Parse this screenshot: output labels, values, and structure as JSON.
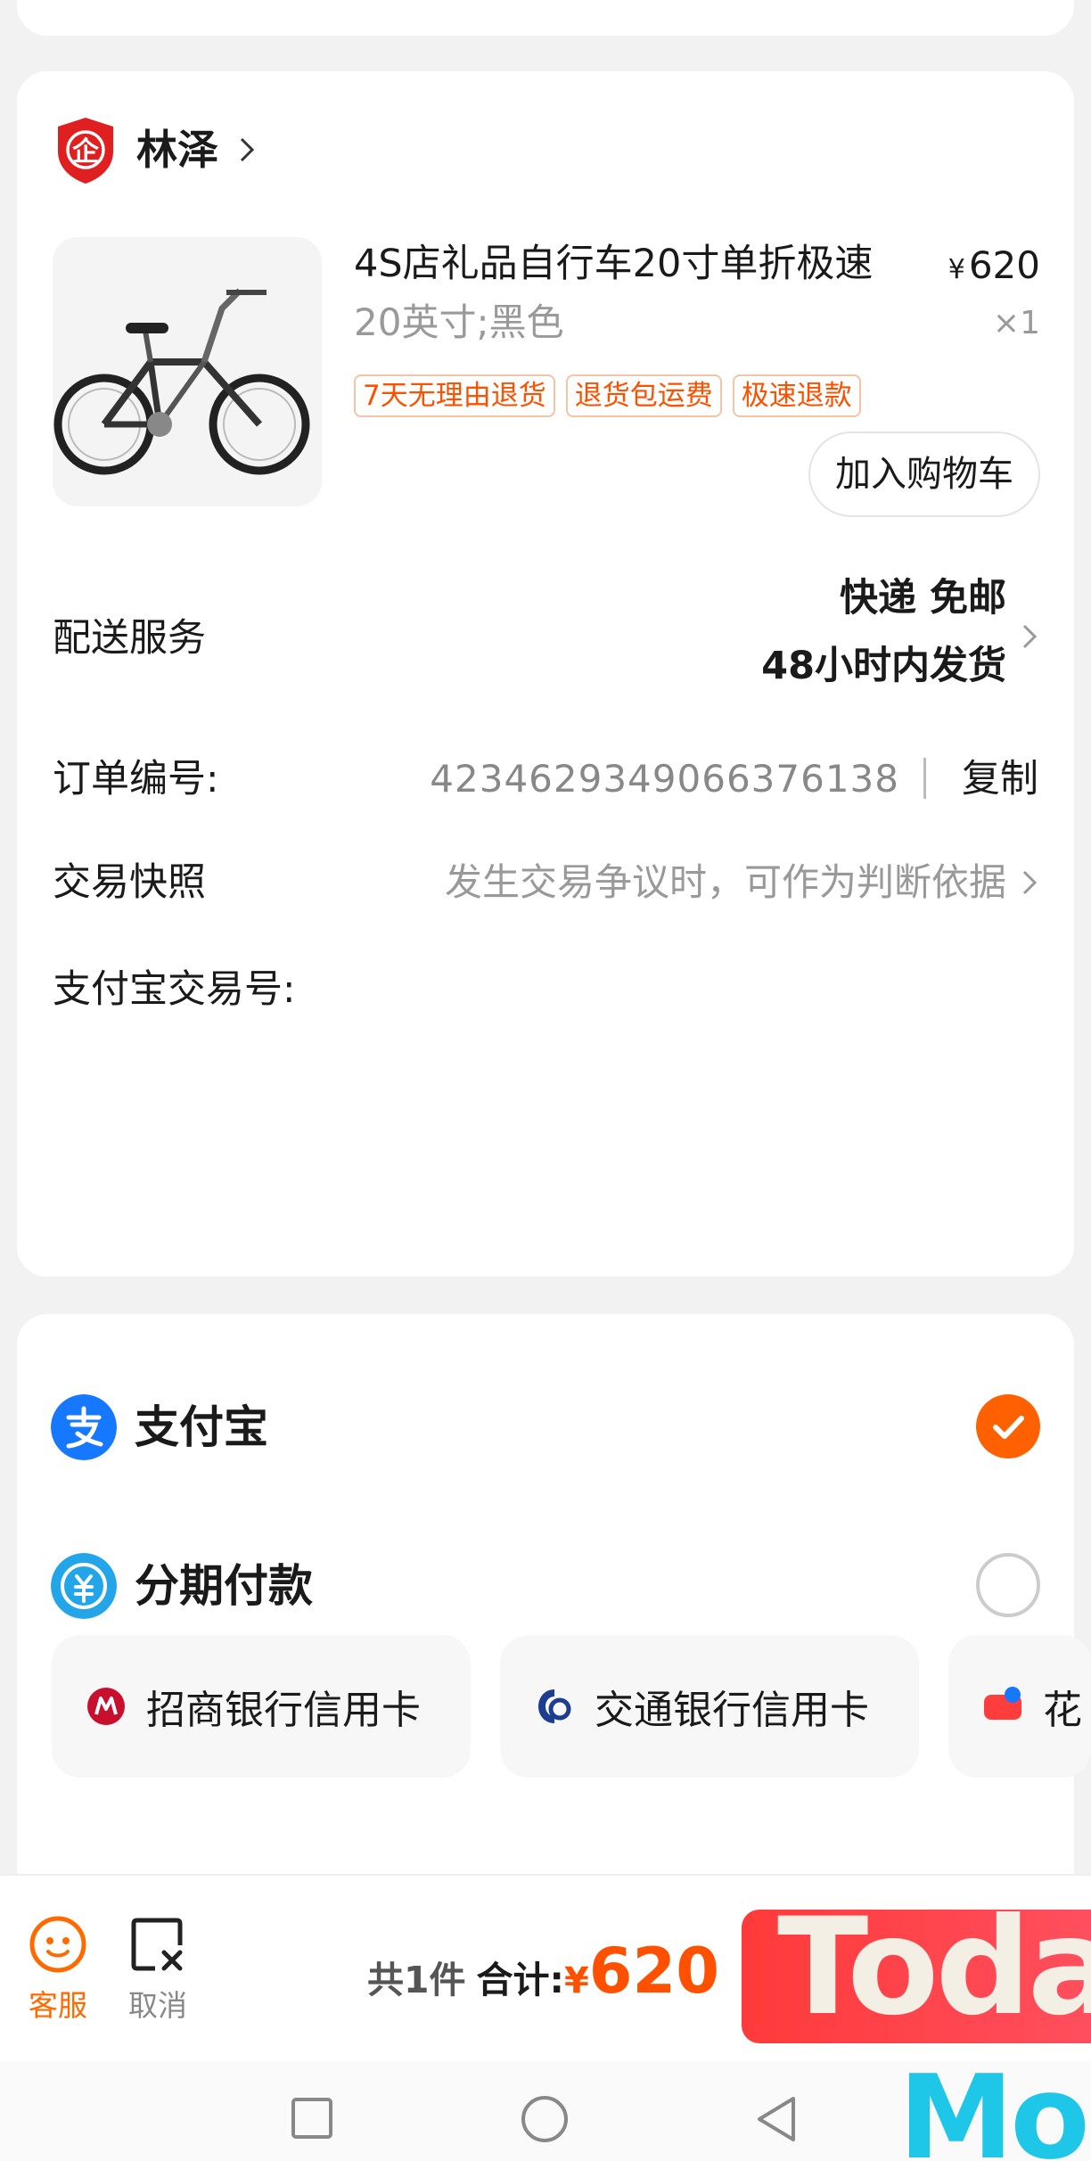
{
  "shop": {
    "name": "林泽",
    "badge_glyph": "企"
  },
  "product": {
    "title": "4S店礼品自行车20寸单折极速",
    "price_symbol": "¥",
    "price": "620",
    "spec": "20英寸;黑色",
    "quantity": "×1",
    "tags": [
      "7天无理由退货",
      "退货包运费",
      "极速退款"
    ],
    "add_to_cart": "加入购物车",
    "image": "folding-bicycle-photo"
  },
  "delivery": {
    "label": "配送服务",
    "line1": "快递 免邮",
    "line2": "48小时内发货"
  },
  "order_number": {
    "label": "订单编号:",
    "value": "4234629349066376138",
    "copy": "复制"
  },
  "snapshot": {
    "label": "交易快照",
    "desc": "发生交易争议时，可作为判断依据"
  },
  "alipay_trade_no": {
    "label": "支付宝交易号:"
  },
  "payment": {
    "methods": [
      {
        "label": "支付宝",
        "icon": "alipay-icon",
        "selected": true,
        "color": "#1677ff"
      },
      {
        "label": "分期付款",
        "icon": "installment-icon",
        "selected": false,
        "color": "#23a6e9"
      }
    ],
    "banks": [
      {
        "label": "招商银行信用卡",
        "icon": "cmb-bank-icon"
      },
      {
        "label": "交通银行信用卡",
        "icon": "bocom-bank-icon"
      },
      {
        "label": "花",
        "icon": "huabei-installment-icon"
      }
    ]
  },
  "bottom_bar": {
    "service": "客服",
    "cancel": "取消",
    "count_text": "共1件",
    "total_label": "合计:",
    "total_symbol": "¥",
    "total": "620"
  },
  "overlay": {
    "today": "Toda",
    "more": "Mor"
  },
  "colors": {
    "accent": "#ff5000",
    "alipay_blue": "#1677ff",
    "shop_red": "#e02020"
  }
}
